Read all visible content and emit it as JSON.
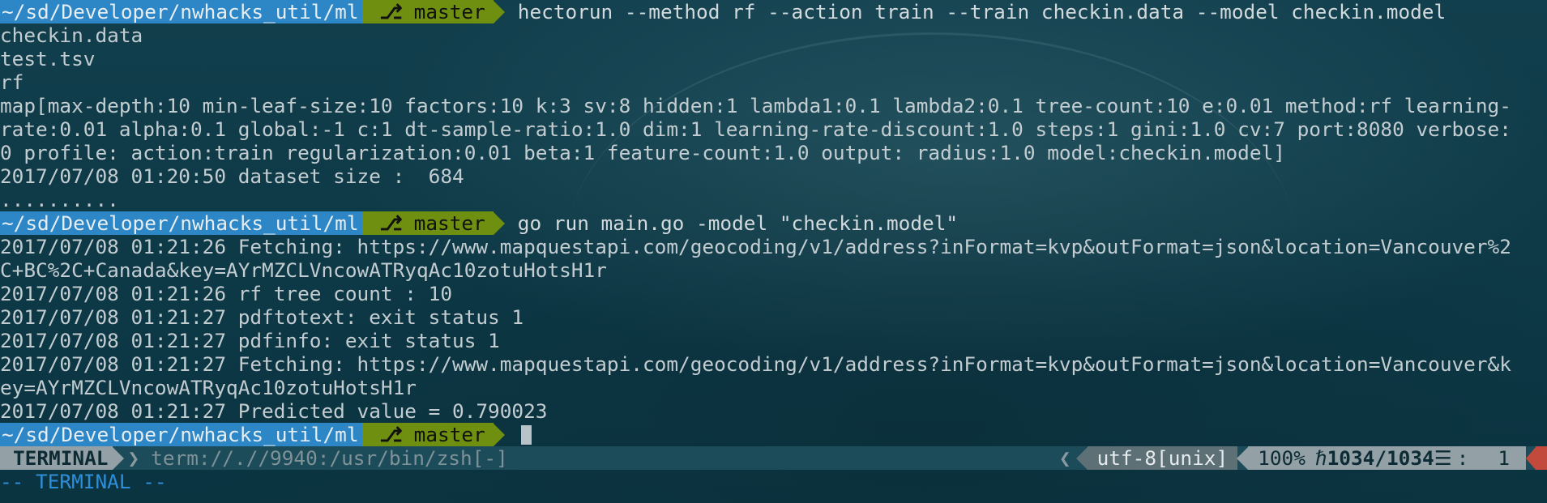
{
  "prompt": {
    "path": "~/sd/Developer/nwhacks_util/ml",
    "branch_icon": "",
    "branch": "master"
  },
  "session": {
    "cmd1": "hectorun --method rf --action train --train checkin.data --model checkin.model",
    "output1": [
      "checkin.data",
      "test.tsv",
      "rf",
      "map[max-depth:10 min-leaf-size:10 factors:10 k:3 sv:8 hidden:1 lambda1:0.1 lambda2:0.1 tree-count:10 e:0.01 method:rf learning-",
      "rate:0.01 alpha:0.1 global:-1 c:1 dt-sample-ratio:1.0 dim:1 learning-rate-discount:1.0 steps:1 gini:1.0 cv:7 port:8080 verbose:",
      "0 profile: action:train regularization:0.01 beta:1 feature-count:1.0 output: radius:1.0 model:checkin.model]",
      "2017/07/08 01:20:50 dataset size :  684",
      ".........."
    ],
    "cmd2": "go run main.go -model \"checkin.model\"",
    "output2": [
      "2017/07/08 01:21:26 Fetching: https://www.mapquestapi.com/geocoding/v1/address?inFormat=kvp&outFormat=json&location=Vancouver%2",
      "C+BC%2C+Canada&key=AYrMZCLVncowATRyqAc10zotuHotsH1r",
      "2017/07/08 01:21:26 rf tree count : 10",
      "2017/07/08 01:21:27 pdftotext: exit status 1",
      "2017/07/08 01:21:27 pdfinfo: exit status 1",
      "2017/07/08 01:21:27 Fetching: https://www.mapquestapi.com/geocoding/v1/address?inFormat=kvp&outFormat=json&location=Vancouver&k",
      "ey=AYrMZCLVncowATRyqAc10zotuHotsH1r",
      "2017/07/08 01:21:27 Predicted value = 0.790023"
    ]
  },
  "statusbar": {
    "mode": "TERMINAL",
    "buffer": "term://.//9940:/usr/bin/zsh[-]",
    "encoding": "utf-8[unix]",
    "percent": "100%",
    "line_icon": "",
    "line_pos": "1034/1034",
    "col_icon": "☰",
    "col_sep": ":",
    "col": "1"
  },
  "cmdline": "-- TERMINAL --",
  "colors": {
    "background": "#0f3a48",
    "prompt_path_bg": "#2d86c6",
    "prompt_branch_bg": "#6f8f10",
    "mode_bg": "#93a1a6",
    "mode_text_color": "#2e8fd8"
  }
}
